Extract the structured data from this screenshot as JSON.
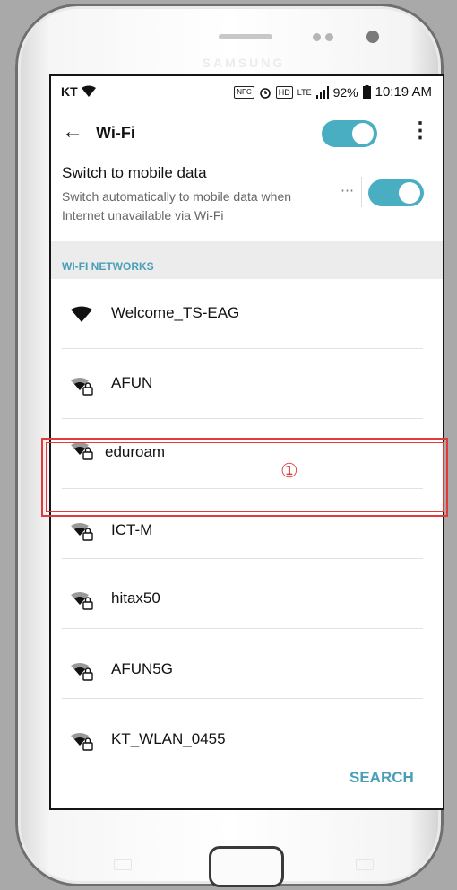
{
  "status_bar": {
    "carrier": "KT",
    "nfc": "NFC",
    "hd": "HD",
    "network": "LTE",
    "battery": "92%",
    "time": "10:19 AM"
  },
  "app_bar": {
    "back_icon": "arrow-left-icon",
    "title": "Wi-Fi",
    "wifi_enabled": true,
    "more_icon": "more-vert-icon"
  },
  "mobile_data": {
    "title": "Switch to mobile data",
    "subtitle": "Switch automatically to mobile data when Internet unavailable via Wi-Fi",
    "more_label": "⋯",
    "enabled": true
  },
  "section_header": "WI-FI NETWORKS",
  "networks": [
    {
      "name": "Welcome_TS-EAG",
      "secured": false,
      "signal": "full"
    },
    {
      "name": "AFUN",
      "secured": true,
      "signal": "medium"
    },
    {
      "name": "eduroam",
      "secured": true,
      "signal": "medium"
    },
    {
      "name": "ICT-M",
      "secured": true,
      "signal": "medium"
    },
    {
      "name": "hitax50",
      "secured": true,
      "signal": "medium"
    },
    {
      "name": "AFUN5G",
      "secured": true,
      "signal": "medium"
    },
    {
      "name": "KT_WLAN_0455",
      "secured": true,
      "signal": "medium"
    }
  ],
  "search_button": "SEARCH",
  "phone": {
    "brand": "SAMSUNG"
  },
  "annotation": {
    "marker": "①",
    "color": "#e03a3a"
  },
  "colors": {
    "accent": "#4aaec2",
    "section_text": "#4a9fb7"
  }
}
